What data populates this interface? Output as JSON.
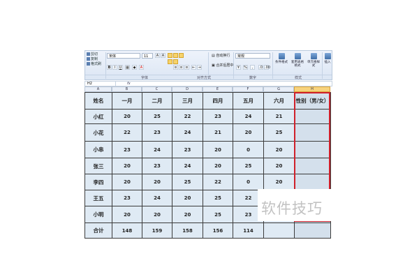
{
  "ribbon": {
    "clipboard": {
      "cut": "剪切",
      "copy": "复制",
      "format_painter": "格式刷"
    },
    "font_name": "宋体",
    "font_size": "11",
    "bold": "B",
    "italic": "I",
    "underline": "U",
    "wrap_text": "自动换行",
    "merge_center": "合并后居中",
    "number_format": "常规",
    "conditional_format": "条件格式",
    "format_table": "套用表格格式",
    "cell_styles": "单元格样式",
    "insert": "插入",
    "group_labels": {
      "font": "字体",
      "alignment": "对齐方式",
      "number": "数字",
      "styles": "样式"
    }
  },
  "formula_bar": {
    "name_box": "H2",
    "fx": "fx"
  },
  "columns": [
    "A",
    "B",
    "C",
    "D",
    "E",
    "F",
    "G",
    "H"
  ],
  "table": {
    "headers": [
      "姓名",
      "一月",
      "二月",
      "三月",
      "四月",
      "五月",
      "六月",
      "性别（男/女）"
    ],
    "rows": [
      [
        "小红",
        "20",
        "25",
        "22",
        "23",
        "24",
        "21",
        ""
      ],
      [
        "小花",
        "22",
        "23",
        "24",
        "21",
        "20",
        "25",
        ""
      ],
      [
        "小串",
        "23",
        "24",
        "23",
        "20",
        "0",
        "20",
        ""
      ],
      [
        "张三",
        "20",
        "23",
        "24",
        "20",
        "25",
        "20",
        ""
      ],
      [
        "李四",
        "20",
        "20",
        "25",
        "22",
        "0",
        "20",
        ""
      ],
      [
        "王五",
        "23",
        "24",
        "20",
        "25",
        "22",
        "",
        ""
      ],
      [
        "小明",
        "20",
        "20",
        "20",
        "25",
        "23",
        "",
        ""
      ],
      [
        "合计",
        "148",
        "159",
        "158",
        "156",
        "114",
        "",
        ""
      ]
    ]
  },
  "watermark": "软件技巧",
  "colors": {
    "selection_border": "#d0202a",
    "cell_fill": "#dfeaf4",
    "header_selected": "#f7d37d"
  }
}
